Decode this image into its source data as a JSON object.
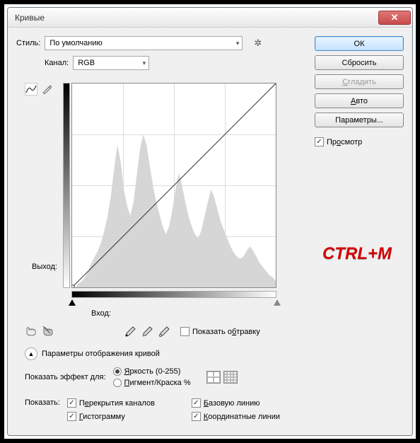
{
  "window": {
    "title": "Кривые"
  },
  "style": {
    "label": "Стиль:",
    "value": "По умолчанию"
  },
  "channel": {
    "label": "Канал:",
    "value": "RGB"
  },
  "buttons": {
    "ok": "ОК",
    "reset": "Сбросить",
    "smooth": "Сгладить",
    "auto": "Авто",
    "options": "Параметры..."
  },
  "preview": {
    "label": "Просмотр",
    "checked": true
  },
  "output": {
    "label": "Выход:"
  },
  "input": {
    "label": "Вход:"
  },
  "clipping": {
    "label": "Показать обтравку",
    "checked": false
  },
  "disclosure": {
    "label": "Параметры отображения кривой"
  },
  "effect": {
    "label": "Показать эффект для:",
    "light": "Яркость (0-255)",
    "pigment": "Пигмент/Краска %",
    "selected": "light"
  },
  "show": {
    "label": "Показать:",
    "overlays": "Перекрытия каналов",
    "baseline": "Базовую линию",
    "histogram": "Гистограмму",
    "intersection": "Координатные линии"
  },
  "annotation": "CTRL+M",
  "chart_data": {
    "type": "line",
    "title": "Curves",
    "xlabel": "Вход",
    "ylabel": "Выход",
    "xlim": [
      0,
      255
    ],
    "ylim": [
      0,
      255
    ],
    "series": [
      {
        "name": "curve",
        "x": [
          0,
          255
        ],
        "y": [
          0,
          255
        ]
      }
    ],
    "histogram_profile": [
      0,
      0,
      2,
      3,
      5,
      8,
      12,
      15,
      18,
      22,
      28,
      35,
      45,
      58,
      70,
      62,
      48,
      40,
      35,
      42,
      55,
      68,
      75,
      70,
      60,
      50,
      42,
      36,
      30,
      26,
      30,
      38,
      48,
      56,
      50,
      42,
      35,
      30,
      26,
      24,
      28,
      35,
      42,
      48,
      44,
      38,
      32,
      28,
      24,
      20,
      17,
      15,
      14,
      15,
      18,
      20,
      18,
      15,
      12,
      10,
      8,
      6,
      5,
      3
    ]
  }
}
